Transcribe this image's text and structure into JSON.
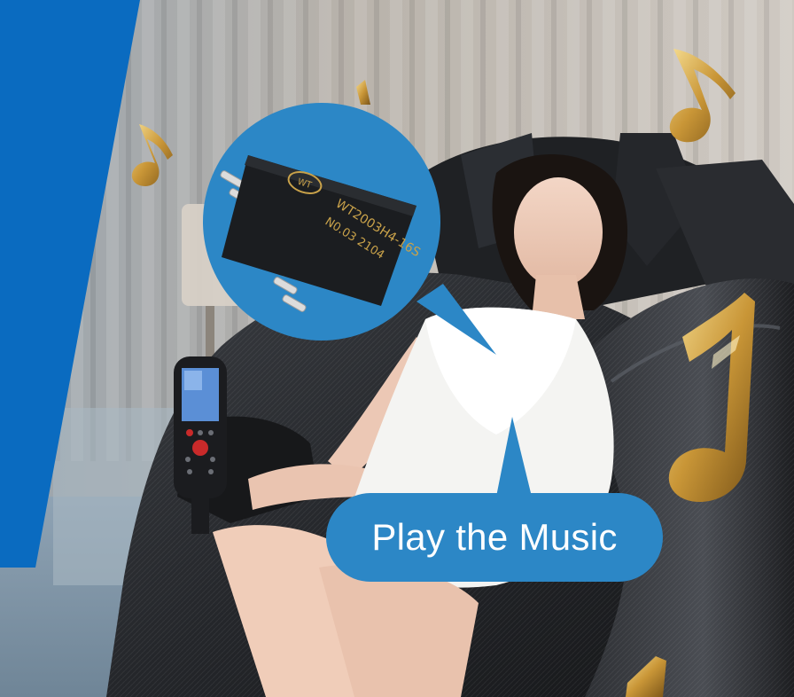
{
  "bubble_label": "Play the Music",
  "chip": {
    "logo": "WT",
    "part_number": "WT2003H4-16S",
    "lot_code": "N0.03 2104"
  },
  "colors": {
    "brand_blue": "#0a6bc0",
    "bubble_blue": "#2c87c6",
    "chip_body": "#1b1d20",
    "chip_marking": "#c9a24a",
    "gold": "#d4a648"
  },
  "icons": [
    "music-note-icon"
  ]
}
